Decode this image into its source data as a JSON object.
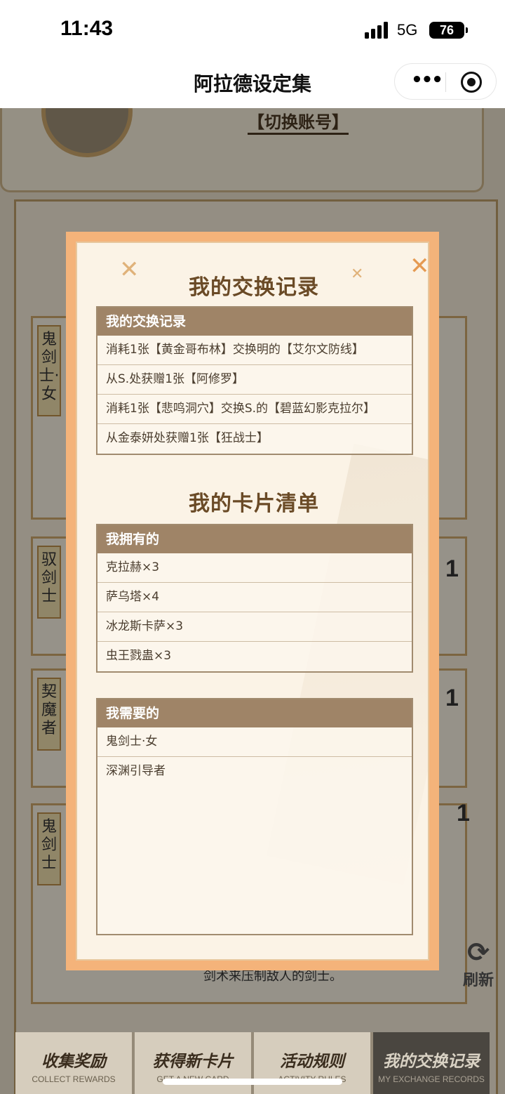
{
  "status_bar": {
    "time": "11:43",
    "network": "5G",
    "battery": "76"
  },
  "nav": {
    "title": "阿拉德设定集",
    "more_icon": "•••"
  },
  "background": {
    "switch_account": "【切换账号】",
    "cards": [
      {
        "role": "鬼剑士·女"
      },
      {
        "role": "驭剑士",
        "count": "1"
      },
      {
        "role": "契魔者",
        "count": "1"
      },
      {
        "role": "鬼剑士",
        "count": "1"
      }
    ],
    "desc": "剑术来压制敌人的剑士。",
    "refresh_label": "刷新"
  },
  "modal": {
    "exchange_title": "我的交换记录",
    "exchange_header": "我的交换记录",
    "exchange_records": [
      "消耗1张【黄金哥布林】交换明的【艾尔文防线】",
      "从S.处获赠1张【阿修罗】",
      "消耗1张【悲鸣洞穴】交换S.的【碧蓝幻影克拉尔】",
      "从金泰妍处获赠1张【狂战士】"
    ],
    "cards_title": "我的卡片清单",
    "owned_header": "我拥有的",
    "owned": [
      "克拉赫×3",
      "萨乌塔×4",
      "冰龙斯卡萨×3",
      "虫王戮蛊×3"
    ],
    "needed_header": "我需要的",
    "needed": [
      "鬼剑士·女",
      "深渊引导者"
    ],
    "close_icon": "✕"
  },
  "tabs": [
    {
      "cn": "收集奖励",
      "en": "COLLECT REWARDS"
    },
    {
      "cn": "获得新卡片",
      "en": "GET A NEW CARD"
    },
    {
      "cn": "活动规则",
      "en": "ACTIVITY RULES"
    },
    {
      "cn": "我的交换记录",
      "en": "MY EXCHANGE RECORDS"
    }
  ]
}
